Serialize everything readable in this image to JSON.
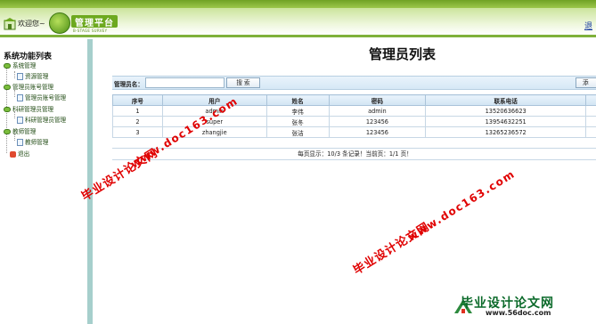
{
  "header": {
    "welcome": "欢迎您~",
    "logo_title": "管理平台",
    "logo_sub": "B-STAGE SURVEY",
    "logout": "退"
  },
  "sidebar": {
    "title": "系统功能列表",
    "items": [
      {
        "label": "系统管理"
      },
      {
        "label": "资源管理"
      },
      {
        "label": "管理员账号管理"
      },
      {
        "label": "管理员账号管理"
      },
      {
        "label": "科研管理员管理"
      },
      {
        "label": "科研管理员管理"
      },
      {
        "label": "教师管理"
      },
      {
        "label": "教师管理"
      },
      {
        "label": "退出"
      }
    ]
  },
  "main": {
    "title": "管理员列表",
    "search_label": "管理员名：",
    "search_value": "",
    "search_button": "搜  索",
    "add_button": "添",
    "columns": [
      "序号",
      "用户",
      "姓名",
      "密码",
      "联系电话"
    ],
    "rows": [
      [
        "1",
        "admin",
        "李伟",
        "admin",
        "13520636623"
      ],
      [
        "2",
        "super",
        "张冬",
        "123456",
        "13954632251"
      ],
      [
        "3",
        "zhangjie",
        "张洁",
        "123456",
        "13265236572"
      ]
    ],
    "pager": "每页显示：10/3 条记录！当前页：1/1 页！"
  },
  "watermarks": {
    "text": "毕业设计论文网",
    "url": "www.doc163.com",
    "brand_text": "毕业设计论文网",
    "brand_url": "www.56doc.com"
  },
  "colors": {
    "header_green": "#6fa224",
    "sidebar_strip": "#a6cfcc",
    "watermark_red": "#e00000",
    "brand_green": "#0b6a2a"
  }
}
